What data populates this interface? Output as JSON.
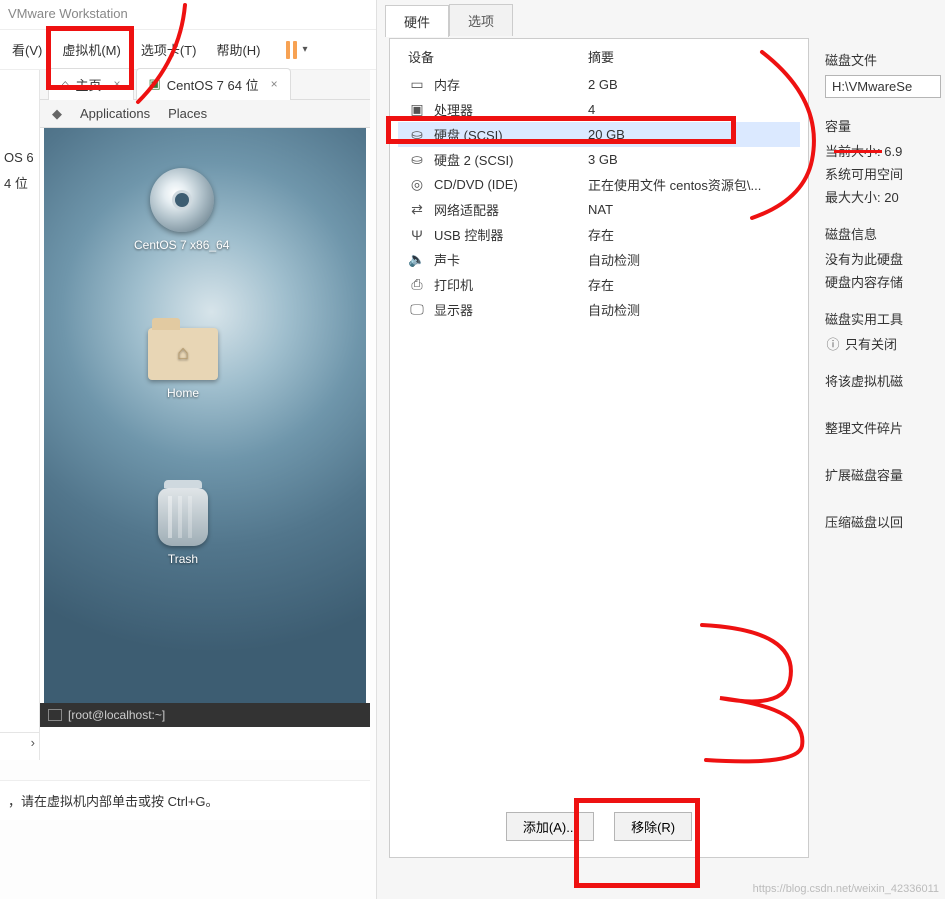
{
  "app_title": "VMware Workstation",
  "menu": {
    "view": "看(V)",
    "vm": "虚拟机(M)",
    "tabs": "选项卡(T)",
    "help": "帮助(H)"
  },
  "tabs": {
    "home": "主页",
    "vmname": "CentOS 7 64 位"
  },
  "left_list": {
    "item1": "OS 6",
    "item2": "4 位"
  },
  "gnome": {
    "applications": "Applications",
    "places": "Places",
    "disc_label": "CentOS 7 x86_64",
    "home_label": "Home",
    "trash_label": "Trash",
    "terminal": "[root@localhost:~]"
  },
  "hint": "，请在虚拟机内部单击或按 Ctrl+G。",
  "dlg_tabs": {
    "hardware": "硬件",
    "options": "选项"
  },
  "hw_header": {
    "device": "设备",
    "summary": "摘要"
  },
  "hw_rows": [
    {
      "icon": "memory-icon",
      "glyph": "▭",
      "name": "内存",
      "summary": "2 GB"
    },
    {
      "icon": "cpu-icon",
      "glyph": "▣",
      "name": "处理器",
      "summary": "4"
    },
    {
      "icon": "disk-icon",
      "glyph": "⛀",
      "name": "硬盘 (SCSI)",
      "summary": "20 GB"
    },
    {
      "icon": "disk-icon",
      "glyph": "⛀",
      "name": "硬盘 2 (SCSI)",
      "summary": "3 GB"
    },
    {
      "icon": "cd-icon",
      "glyph": "◎",
      "name": "CD/DVD (IDE)",
      "summary": "正在使用文件 centos资源包\\..."
    },
    {
      "icon": "network-icon",
      "glyph": "⇄",
      "name": "网络适配器",
      "summary": "NAT"
    },
    {
      "icon": "usb-icon",
      "glyph": "Ψ",
      "name": "USB 控制器",
      "summary": "存在"
    },
    {
      "icon": "sound-icon",
      "glyph": "🔈",
      "name": "声卡",
      "summary": "自动检测"
    },
    {
      "icon": "printer-icon",
      "glyph": "⎙",
      "name": "打印机",
      "summary": "存在"
    },
    {
      "icon": "display-icon",
      "glyph": "🖵",
      "name": "显示器",
      "summary": "自动检测"
    }
  ],
  "hw_selected_index": 2,
  "hw_buttons": {
    "add": "添加(A)...",
    "remove": "移除(R)"
  },
  "info": {
    "disk_file_label": "磁盘文件",
    "disk_file_value": "H:\\VMwareSe",
    "capacity_label": "容量",
    "current_size": "当前大小: 6.9",
    "free_space": "系统可用空间",
    "max_size": "最大大小: 20",
    "disk_info_label": "磁盘信息",
    "disk_info_1": "没有为此硬盘",
    "disk_info_2": "硬盘内容存储",
    "utilities_label": "磁盘实用工具",
    "util_hint": "只有关闭",
    "util_map": "将该虚拟机磁",
    "util_defrag": "整理文件碎片",
    "util_expand": "扩展磁盘容量",
    "util_compress": "压缩磁盘以回"
  },
  "watermark": "https://blog.csdn.net/weixin_42336011"
}
